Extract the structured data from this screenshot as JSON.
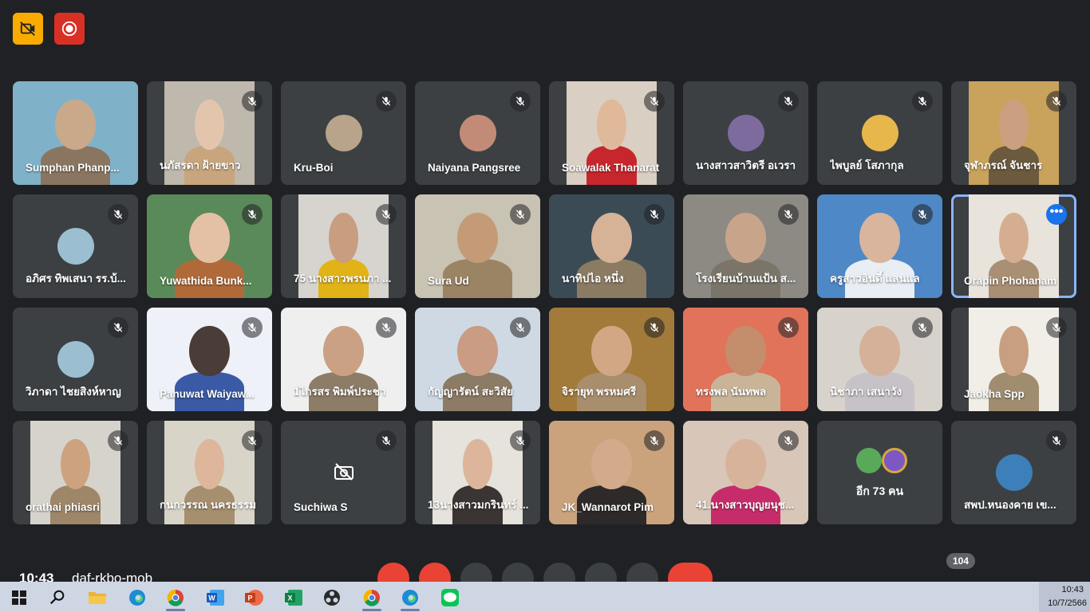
{
  "toolbar_top": {
    "video_off_icon": "video-off-icon",
    "record_icon": "record-icon"
  },
  "participants": [
    {
      "name": "Sumphan Phanp...",
      "muted": false,
      "video": true,
      "avatar": false
    },
    {
      "name": "นภัสรดา ฝ้ายขาว",
      "muted": true,
      "video": true,
      "avatar": false
    },
    {
      "name": "Kru-Boi",
      "muted": true,
      "video": false,
      "avatar": true
    },
    {
      "name": "Naiyana Pangsree",
      "muted": true,
      "video": false,
      "avatar": true
    },
    {
      "name": "Soawalak Thanarat",
      "muted": true,
      "video": true,
      "avatar": false
    },
    {
      "name": "นางสาวสาวิตรี อเวรา",
      "muted": true,
      "video": false,
      "avatar": true
    },
    {
      "name": "ไพบูลย์ โสภากุล",
      "muted": true,
      "video": false,
      "avatar": true
    },
    {
      "name": "จุฬาภรณ์ จันชาร",
      "muted": true,
      "video": true,
      "avatar": false
    },
    {
      "name": "อภิศร ทิพเสนา รร.บ้...",
      "muted": true,
      "video": false,
      "avatar": true
    },
    {
      "name": "Yuwathida Bunk...",
      "muted": true,
      "video": true,
      "avatar": false
    },
    {
      "name": "75 นางสาวพรนภา ...",
      "muted": true,
      "video": true,
      "avatar": false
    },
    {
      "name": "Sura Ud",
      "muted": true,
      "video": true,
      "avatar": false
    },
    {
      "name": "นาทิปไอ หนึ่ง",
      "muted": true,
      "video": true,
      "avatar": false
    },
    {
      "name": "โรงเรียนบ้านแป้น ส...",
      "muted": true,
      "video": true,
      "avatar": false
    },
    {
      "name": "ครูสาวอินดี้ แสนแล",
      "muted": true,
      "video": true,
      "avatar": false
    },
    {
      "name": "Orapin Phohanam",
      "muted": false,
      "video": true,
      "avatar": false,
      "active": true
    },
    {
      "name": "วิภาดา ไชยสิงห์หาญ",
      "muted": true,
      "video": false,
      "avatar": true
    },
    {
      "name": "Panuwat Waiyaw...",
      "muted": true,
      "video": true,
      "avatar": false
    },
    {
      "name": "1ไกรสร พิมพ์ประชา",
      "muted": true,
      "video": true,
      "avatar": false
    },
    {
      "name": "กัญญารัตน์ สะวิสัย",
      "muted": true,
      "video": true,
      "avatar": false
    },
    {
      "name": "จิรายุท พรหมศรี",
      "muted": true,
      "video": true,
      "avatar": false
    },
    {
      "name": "ทรงพล นันทพล",
      "muted": true,
      "video": true,
      "avatar": false
    },
    {
      "name": "นิชาภา เสนาวัง",
      "muted": true,
      "video": true,
      "avatar": false
    },
    {
      "name": "Jaokha Spp",
      "muted": true,
      "video": true,
      "avatar": false
    },
    {
      "name": "orathai phiasri",
      "muted": true,
      "video": true,
      "avatar": false
    },
    {
      "name": "กนกวรรณ นครธรรม",
      "muted": true,
      "video": true,
      "avatar": false
    },
    {
      "name": "Suchiwa S",
      "muted": true,
      "video": false,
      "avatar": false,
      "cam_off": true
    },
    {
      "name": "13นางสาวมกรินทร์ ...",
      "muted": true,
      "video": true,
      "avatar": false
    },
    {
      "name": "JK_Wannarot Pim",
      "muted": true,
      "video": true,
      "avatar": false
    },
    {
      "name": "41.นางสาวบุญยนุช...",
      "muted": true,
      "video": true,
      "avatar": false
    },
    {
      "name": "อีก 73 คน",
      "muted": false,
      "video": false,
      "avatar": false,
      "overflow": true
    },
    {
      "name": "สพป.หนองคาย เข...",
      "muted": true,
      "video": false,
      "avatar": true
    }
  ],
  "meeting": {
    "time": "10:43",
    "code": "daf-rkbo-mob",
    "people_count": "104"
  },
  "taskbar": {
    "apps": [
      "windows-start",
      "search",
      "file-explorer",
      "edge",
      "chrome",
      "word",
      "powerpoint",
      "excel",
      "obs",
      "chrome-profile",
      "edge-profile",
      "line"
    ],
    "time": "10:43",
    "date": "10/7/2566"
  },
  "colors": {
    "background": "#202124",
    "tile": "#3c4043",
    "accent": "#8ab4f8",
    "red": "#ea4335",
    "yellow": "#fbbc04"
  }
}
